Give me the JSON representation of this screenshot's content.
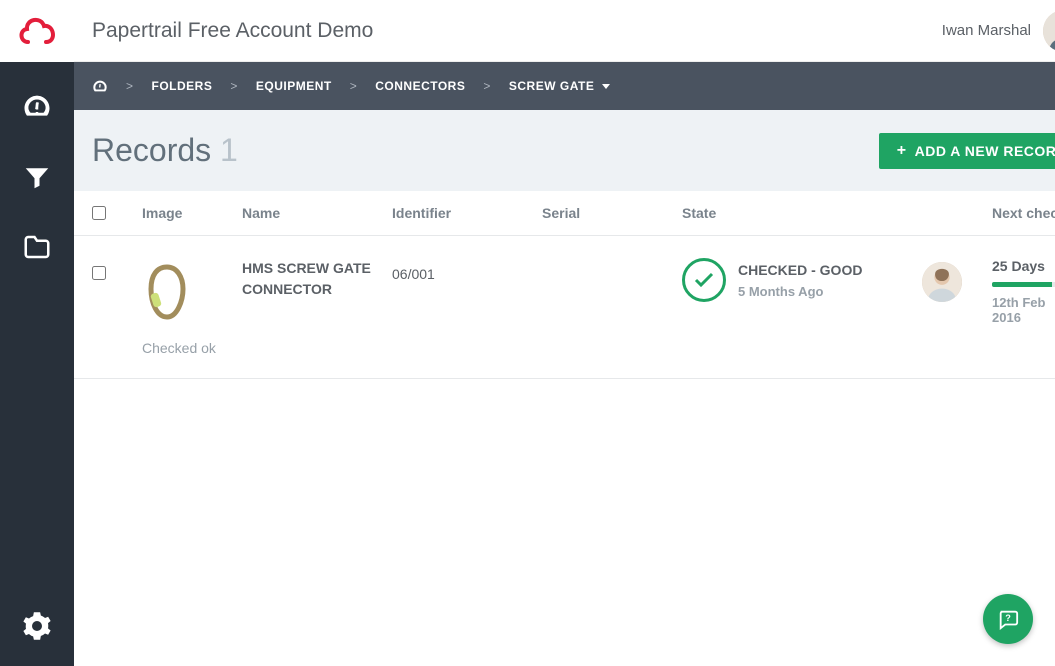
{
  "header": {
    "title": "Papertrail Free Account Demo",
    "user_name": "Iwan Marshal"
  },
  "breadcrumb": {
    "items": [
      "FOLDERS",
      "EQUIPMENT",
      "CONNECTORS",
      "SCREW GATE"
    ]
  },
  "page": {
    "heading": "Records",
    "count": "1",
    "add_button": "ADD A NEW RECORD"
  },
  "columns": {
    "image": "Image",
    "name": "Name",
    "identifier": "Identifier",
    "serial": "Serial",
    "state": "State",
    "next_check": "Next check"
  },
  "records": [
    {
      "name": "HMS SCREW GATE CONNECTOR",
      "identifier": "06/001",
      "serial": "",
      "state_label": "CHECKED - GOOD",
      "state_age": "5 Months Ago",
      "next_check_days": "25 Days",
      "next_check_date": "12th Feb 2016",
      "note": "Checked ok",
      "progress_pct": 70
    }
  ],
  "icons": {
    "logo": "cloud-logo",
    "dashboard": "dashboard-icon",
    "filter": "filter-icon",
    "folder": "folder-icon",
    "settings": "gear-icon",
    "search": "search-icon",
    "home": "home-dashboard-icon",
    "plus": "plus-icon",
    "check": "check-circle-icon",
    "help": "help-chat-icon"
  },
  "colors": {
    "accent": "#1fa463",
    "sidebar": "#28303a",
    "crumb": "#4a5360",
    "brand": "#e31e3b"
  }
}
